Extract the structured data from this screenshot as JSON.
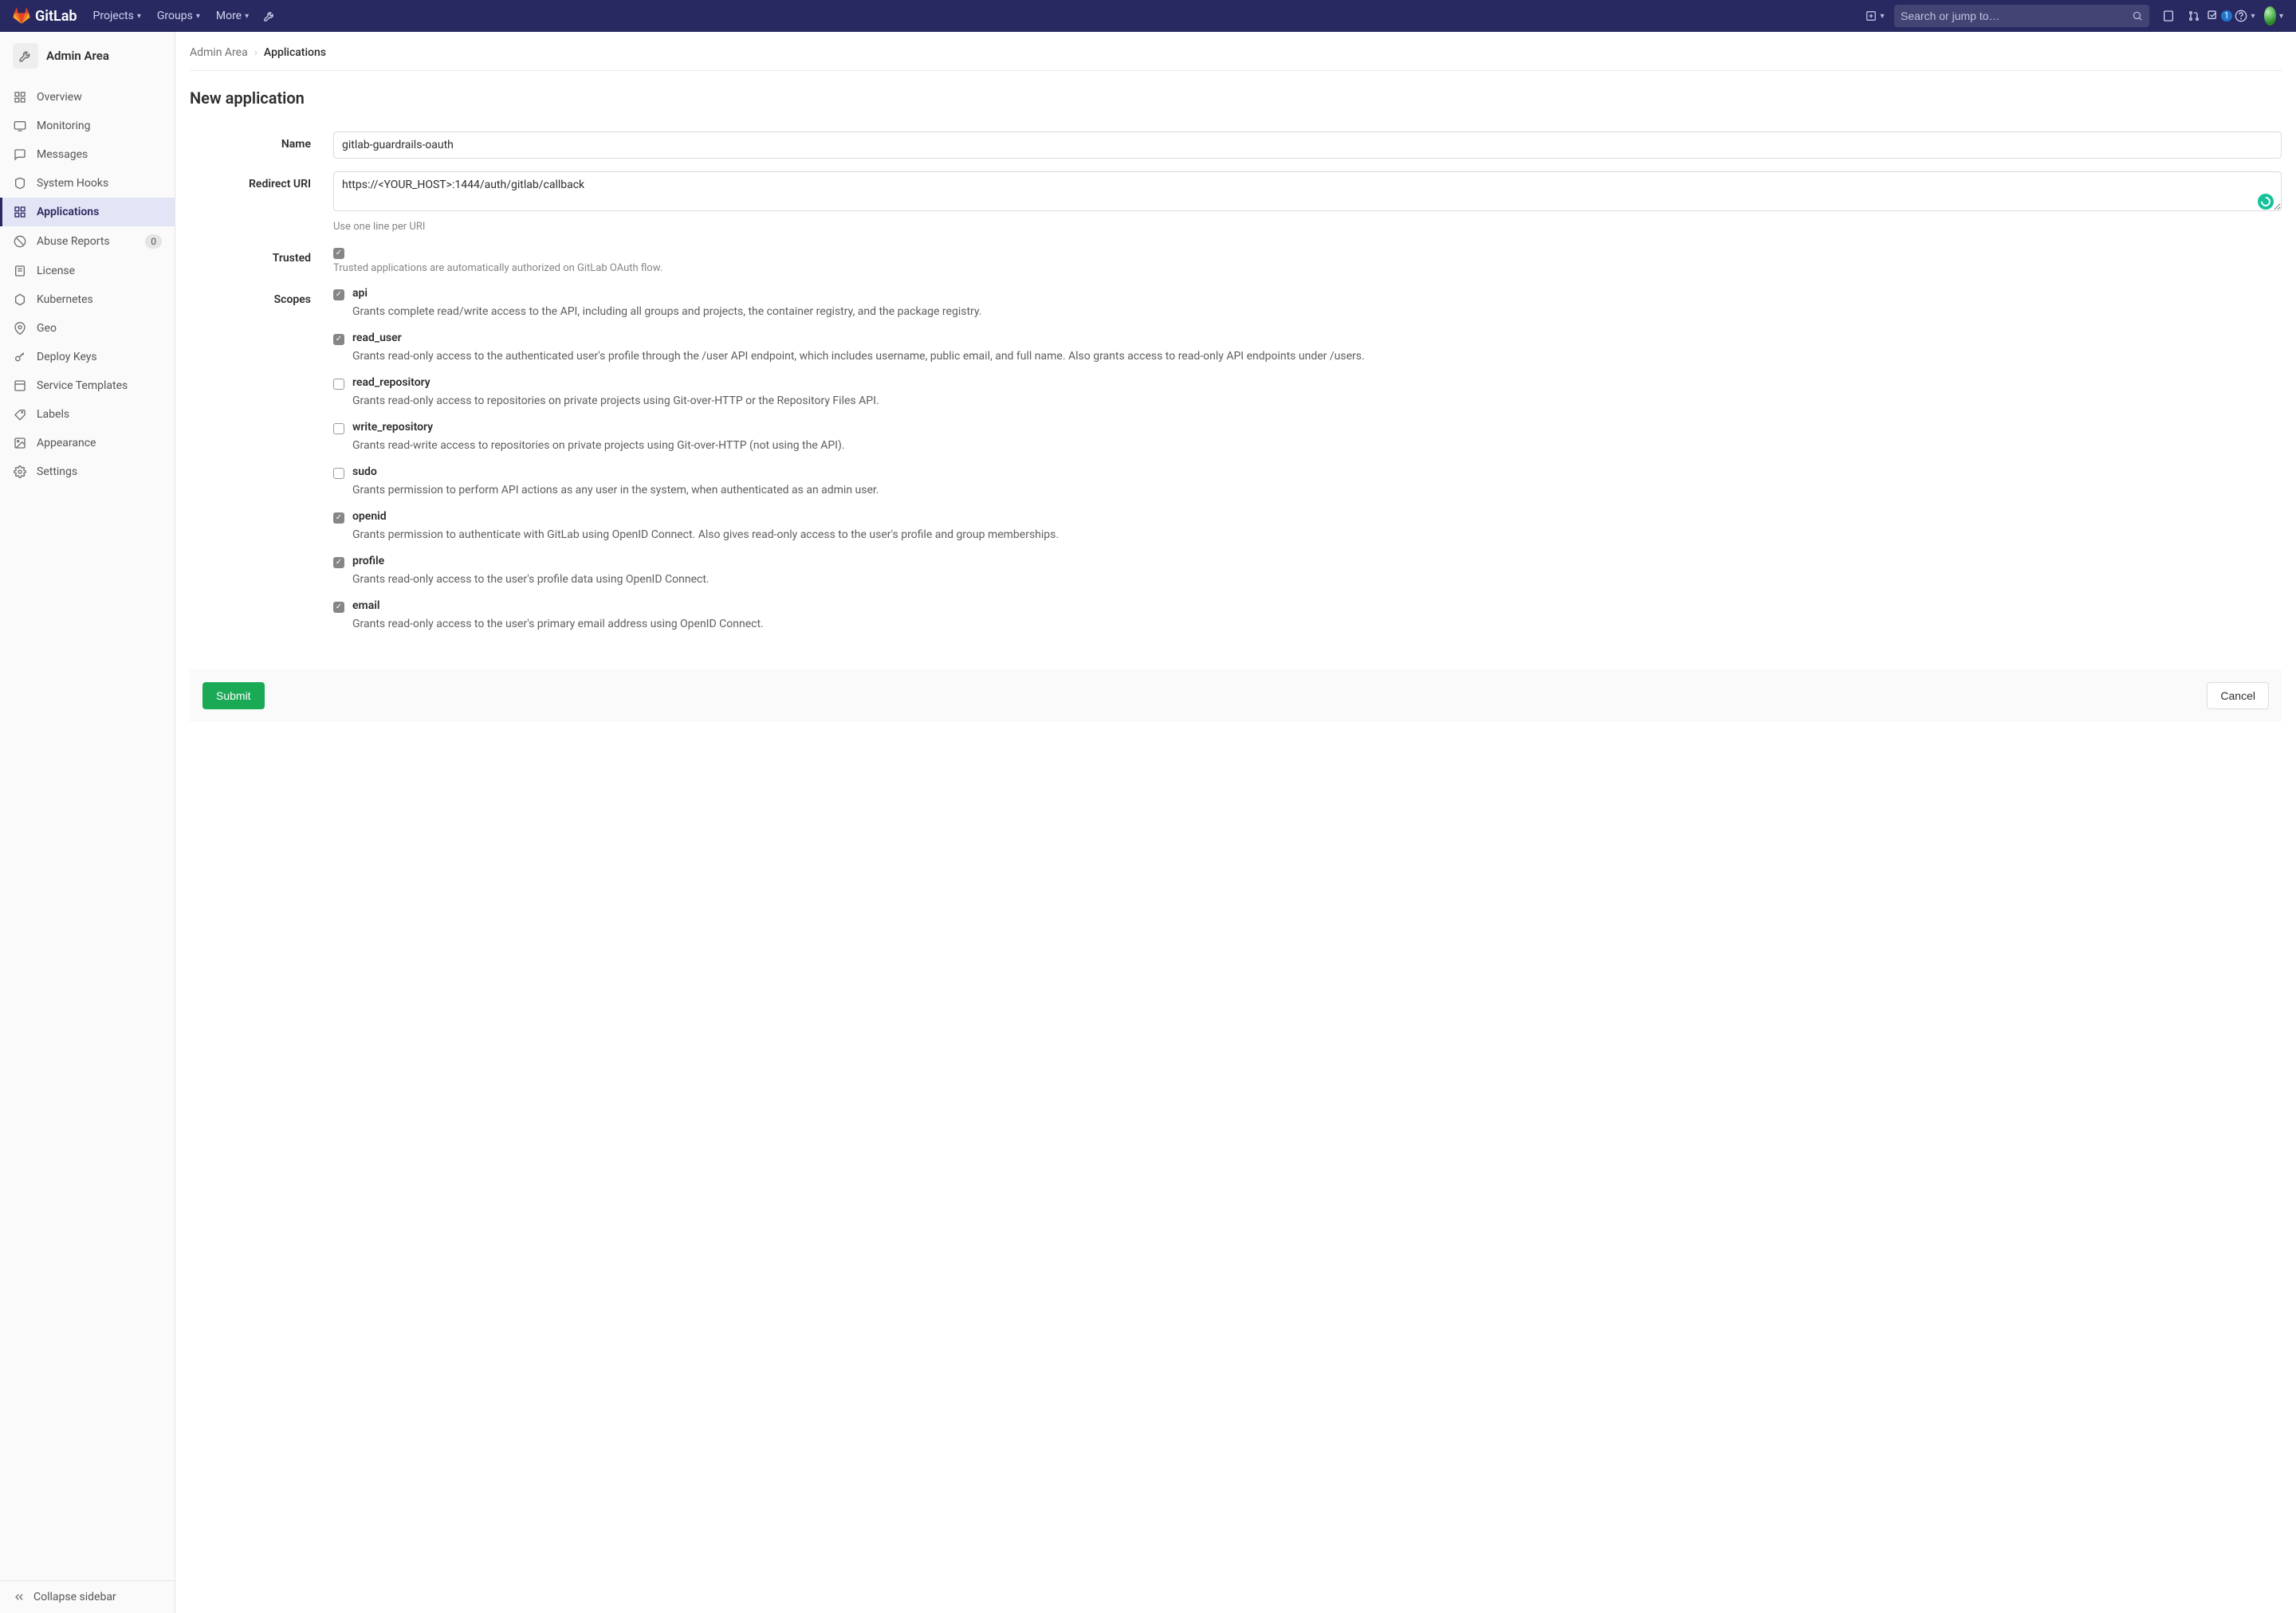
{
  "navbar": {
    "brand": "GitLab",
    "menus": [
      "Projects",
      "Groups",
      "More"
    ],
    "search_placeholder": "Search or jump to…",
    "todo_count": "1"
  },
  "sidebar": {
    "context_title": "Admin Area",
    "items": [
      {
        "label": "Overview"
      },
      {
        "label": "Monitoring"
      },
      {
        "label": "Messages"
      },
      {
        "label": "System Hooks"
      },
      {
        "label": "Applications",
        "active": true
      },
      {
        "label": "Abuse Reports",
        "count": "0"
      },
      {
        "label": "License"
      },
      {
        "label": "Kubernetes"
      },
      {
        "label": "Geo"
      },
      {
        "label": "Deploy Keys"
      },
      {
        "label": "Service Templates"
      },
      {
        "label": "Labels"
      },
      {
        "label": "Appearance"
      },
      {
        "label": "Settings"
      }
    ],
    "collapse_label": "Collapse sidebar"
  },
  "breadcrumb": {
    "root": "Admin Area",
    "current": "Applications"
  },
  "page": {
    "title": "New application",
    "labels": {
      "name": "Name",
      "redirect": "Redirect URI",
      "trusted": "Trusted",
      "scopes": "Scopes"
    },
    "values": {
      "name": "gitlab-guardrails-oauth",
      "redirect_uri": "https://<YOUR_HOST>:1444/auth/gitlab/callback"
    },
    "hints": {
      "redirect": "Use one line per URI",
      "trusted": "Trusted applications are automatically authorized on GitLab OAuth flow."
    },
    "trusted_checked": true,
    "scopes": [
      {
        "key": "api",
        "name": "api",
        "checked": true,
        "desc": "Grants complete read/write access to the API, including all groups and projects, the container registry, and the package registry."
      },
      {
        "key": "read_user",
        "name": "read_user",
        "checked": true,
        "desc": "Grants read-only access to the authenticated user's profile through the /user API endpoint, which includes username, public email, and full name. Also grants access to read-only API endpoints under /users."
      },
      {
        "key": "read_repository",
        "name": "read_repository",
        "checked": false,
        "desc": "Grants read-only access to repositories on private projects using Git-over-HTTP or the Repository Files API."
      },
      {
        "key": "write_repository",
        "name": "write_repository",
        "checked": false,
        "desc": "Grants read-write access to repositories on private projects using Git-over-HTTP (not using the API)."
      },
      {
        "key": "sudo",
        "name": "sudo",
        "checked": false,
        "desc": "Grants permission to perform API actions as any user in the system, when authenticated as an admin user."
      },
      {
        "key": "openid",
        "name": "openid",
        "checked": true,
        "desc": "Grants permission to authenticate with GitLab using OpenID Connect. Also gives read-only access to the user's profile and group memberships."
      },
      {
        "key": "profile",
        "name": "profile",
        "checked": true,
        "desc": "Grants read-only access to the user's profile data using OpenID Connect."
      },
      {
        "key": "email",
        "name": "email",
        "checked": true,
        "desc": "Grants read-only access to the user's primary email address using OpenID Connect."
      }
    ],
    "actions": {
      "submit": "Submit",
      "cancel": "Cancel"
    }
  }
}
